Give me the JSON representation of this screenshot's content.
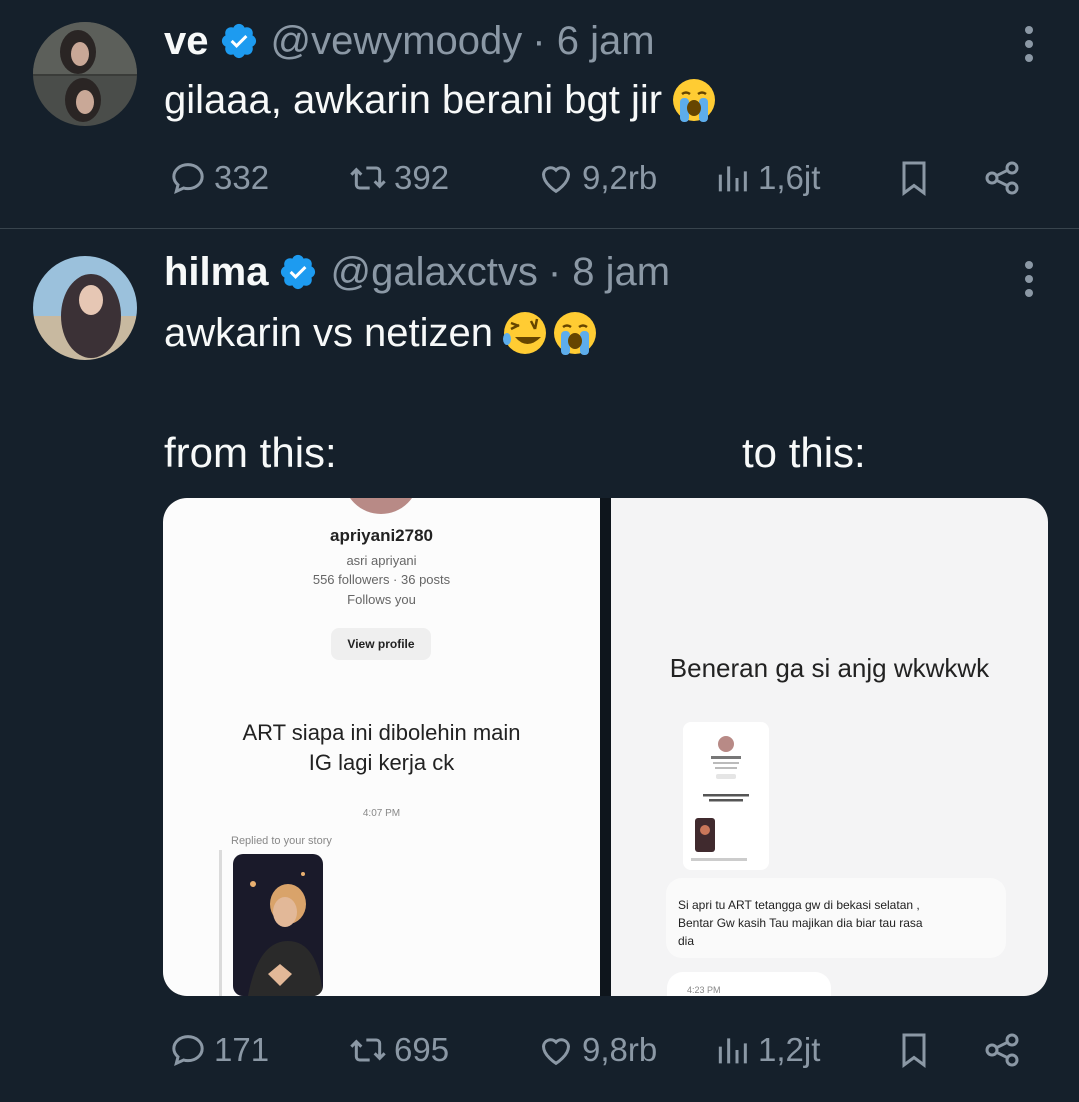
{
  "tweet1": {
    "name": "ve",
    "handle": "@vewymoody",
    "time": "· 6 jam",
    "text": "gilaaa, awkarin berani bgt jir",
    "emoji": [
      "loudly-crying-face"
    ],
    "replies": "332",
    "retweets": "392",
    "likes": "9,2rb",
    "views": "1,6jt"
  },
  "tweet2": {
    "name": "hilma",
    "handle": "@galaxctvs",
    "time": "· 8 jam",
    "text": "awkarin vs netizen",
    "emoji": [
      "rolling-on-floor-laughing",
      "loudly-crying-face"
    ],
    "caption_left": "from this:",
    "caption_right": "to this:",
    "replies": "171",
    "retweets": "695",
    "likes": "9,8rb",
    "views": "1,2jt",
    "image_left": {
      "username": "apriyani2780",
      "fullname": "asri apriyani",
      "stats": "556 followers · 36 posts",
      "follows": "Follows you",
      "button": "View profile",
      "message_line1": "ART siapa ini dibolehin main",
      "message_line2": "IG lagi kerja ck",
      "time": "4:07 PM",
      "replied": "Replied to your story"
    },
    "image_right": {
      "heading": "Beneran ga si anjg wkwkwk",
      "reply_line1": "Si apri tu ART tetangga gw di bekasi selatan ,",
      "reply_line2": "Bentar Gw kasih Tau majikan dia biar tau rasa",
      "reply_line3": "dia",
      "time": "4:23 PM"
    }
  },
  "colors": {
    "background": "#15202b",
    "text_primary": "#f7f9f9",
    "text_secondary": "#8b98a5",
    "verified": "#1d9bf0",
    "divider": "#38444d"
  }
}
